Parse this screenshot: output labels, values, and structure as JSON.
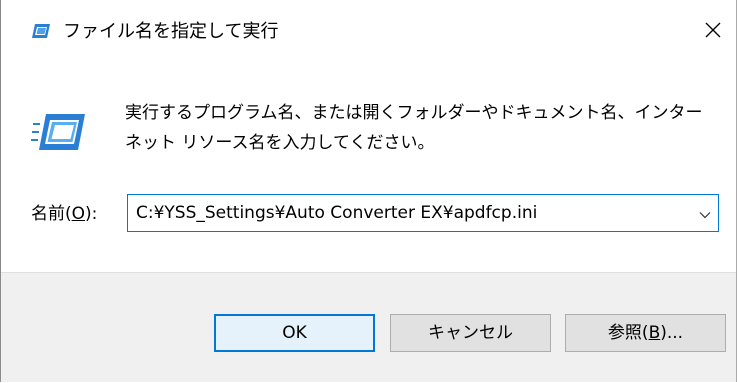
{
  "window": {
    "title": "ファイル名を指定して実行",
    "close_glyph": "✕"
  },
  "message": {
    "line1": "実行するプログラム名、または開くフォルダーやドキュメント名、インター",
    "line2": "ネット リソース名を入力してください。"
  },
  "name_field": {
    "label_prefix": "名前(",
    "label_accel": "O",
    "label_suffix": "):",
    "value": "C:¥YSS_Settings¥Auto Converter EX¥apdfcp.ini"
  },
  "buttons": {
    "ok": "OK",
    "cancel": "キャンセル",
    "browse_prefix": "参照(",
    "browse_accel": "B",
    "browse_suffix": ")..."
  },
  "icons": {
    "title": "run-dialog-icon",
    "main": "run-dialog-icon",
    "close": "close-icon",
    "dropdown": "chevron-down-icon"
  },
  "colors": {
    "accent": "#0078d7",
    "footer_bg": "#f0f0f0",
    "button_bg": "#e1e1e1"
  }
}
